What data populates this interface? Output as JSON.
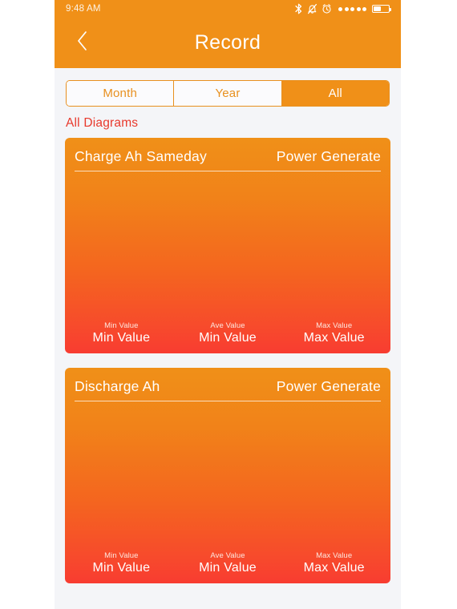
{
  "statusbar": {
    "time": "9:48 AM",
    "icons": [
      "bluetooth-icon",
      "mute-icon",
      "alarm-icon",
      "signal-dots",
      "battery-icon"
    ],
    "signal_dots": 5,
    "battery_level_pct": 48
  },
  "navbar": {
    "back_icon": "chevron-left-icon",
    "title": "Record"
  },
  "segmented": {
    "options": [
      {
        "label": "Month",
        "selected": false
      },
      {
        "label": "Year",
        "selected": false
      },
      {
        "label": "All",
        "selected": true
      }
    ]
  },
  "section": {
    "label": "All Diagrams"
  },
  "cards": [
    {
      "title": "Charge Ah Sameday",
      "subtitle": "Power Generate",
      "stats": [
        {
          "label": "Min Value",
          "value": "Min Value"
        },
        {
          "label": "Ave Value",
          "value": "Min Value"
        },
        {
          "label": "Max Value",
          "value": "Max Value"
        }
      ]
    },
    {
      "title": "Discharge Ah",
      "subtitle": "Power Generate",
      "stats": [
        {
          "label": "Min Value",
          "value": "Min Value"
        },
        {
          "label": "Ave Value",
          "value": "Min Value"
        },
        {
          "label": "Max Value",
          "value": "Max Value"
        }
      ]
    }
  ],
  "colors": {
    "header_orange": "#f09018",
    "card_top": "#f09018",
    "card_bottom": "#f83c31",
    "accent_red": "#e8392c",
    "page_bg": "#f4f5f8"
  }
}
